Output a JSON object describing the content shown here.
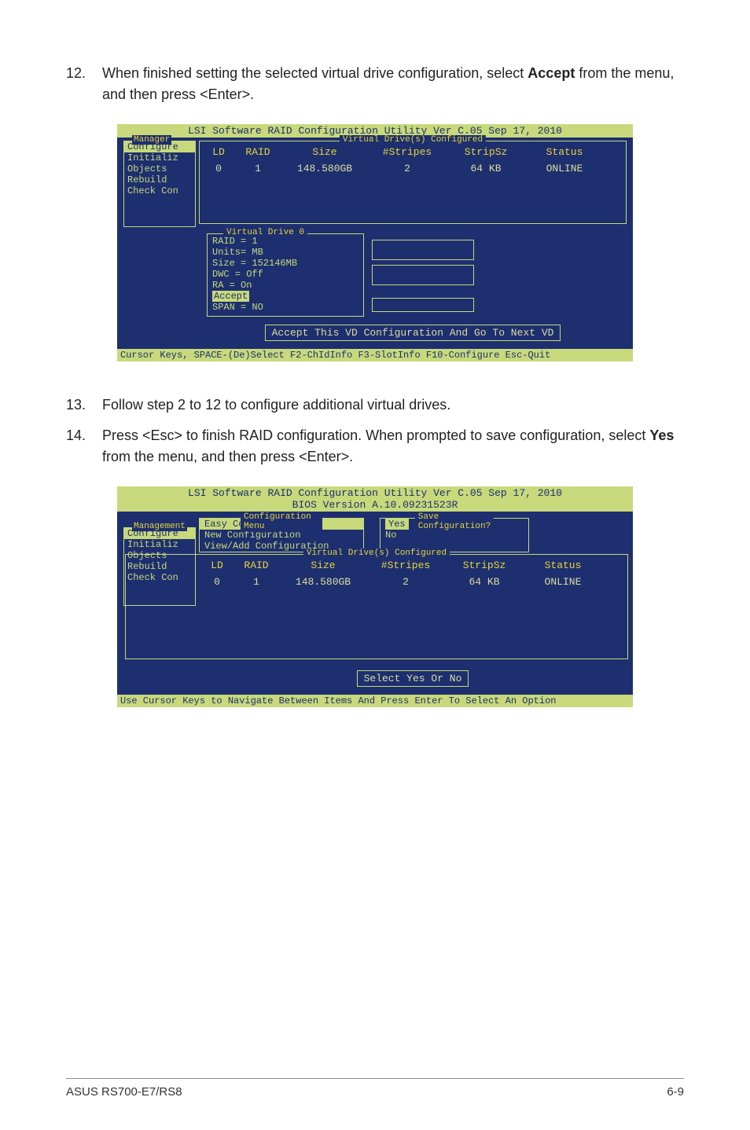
{
  "steps": {
    "s12": {
      "num": "12.",
      "text_before": "When finished setting the selected virtual drive configuration, select ",
      "bold": "Accept",
      "text_after": " from the menu, and then press <Enter>."
    },
    "s13": {
      "num": "13.",
      "text": "Follow step 2 to 12 to configure additional virtual drives."
    },
    "s14": {
      "num": "14.",
      "text_before": "Press <Esc> to finish RAID configuration. When prompted to save configuration, select ",
      "bold": "Yes",
      "text_after": " from the menu, and then press <Enter>."
    }
  },
  "bios1": {
    "title": "LSI Software RAID Configuration Utility Ver C.05 Sep 17, 2010",
    "boxtitle": "Virtual Drive(s) Configured",
    "headers": {
      "ld": "LD",
      "raid": "RAID",
      "size": "Size",
      "stripes": "#Stripes",
      "stripsz": "StripSz",
      "status": "Status"
    },
    "row": {
      "ld": "0",
      "raid": "1",
      "size": "148.580GB",
      "stripes": "2",
      "stripsz": "64 KB",
      "status": "ONLINE"
    },
    "leftmenu": {
      "legend": "Manager",
      "items": [
        "Configure",
        "Initializ",
        "Objects",
        "Rebuild",
        "Check Con"
      ]
    },
    "vdbox": {
      "legend": "Virtual Drive 0",
      "lines": [
        "RAID = 1",
        "Units= MB",
        "Size = 152146MB",
        "DWC  = Off",
        "RA   = On",
        "Accept",
        "SPAN = NO"
      ],
      "selected_index": 5
    },
    "action": "Accept This VD Configuration And Go To Next VD",
    "footer": "Cursor Keys, SPACE-(De)Select F2-ChIdInfo F3-SlotInfo F10-Configure Esc-Quit"
  },
  "bios2": {
    "title": "LSI Software RAID Configuration Utility Ver C.05 Sep 17, 2010",
    "subtitle": "BIOS Version   A.10.09231523R",
    "leftmenu": {
      "legend": "Management",
      "items": [
        "Configure",
        "Initializ",
        "Objects",
        "Rebuild",
        "Check Con"
      ]
    },
    "confmenu": {
      "legend": "Configuration Menu",
      "items": [
        "Easy Configuration",
        "New Configuration",
        "View/Add Configuration"
      ],
      "selected_index": 0
    },
    "savebox": {
      "legend": "Save Configuration?",
      "options": [
        "Yes",
        "No"
      ],
      "selected_index": 0
    },
    "vdconf": {
      "legend": "Virtual Drive(s) Configured",
      "headers": {
        "ld": "LD",
        "raid": "RAID",
        "size": "Size",
        "stripes": "#Stripes",
        "stripsz": "StripSz",
        "status": "Status"
      },
      "row": {
        "ld": "0",
        "raid": "1",
        "size": "148.580GB",
        "stripes": "2",
        "stripsz": "64 KB",
        "status": "ONLINE"
      }
    },
    "action": "Select Yes Or No",
    "footer": "Use Cursor Keys to Navigate Between Items And Press Enter To Select An Option"
  },
  "pagefooter": {
    "left": "ASUS RS700-E7/RS8",
    "right": "6-9"
  }
}
